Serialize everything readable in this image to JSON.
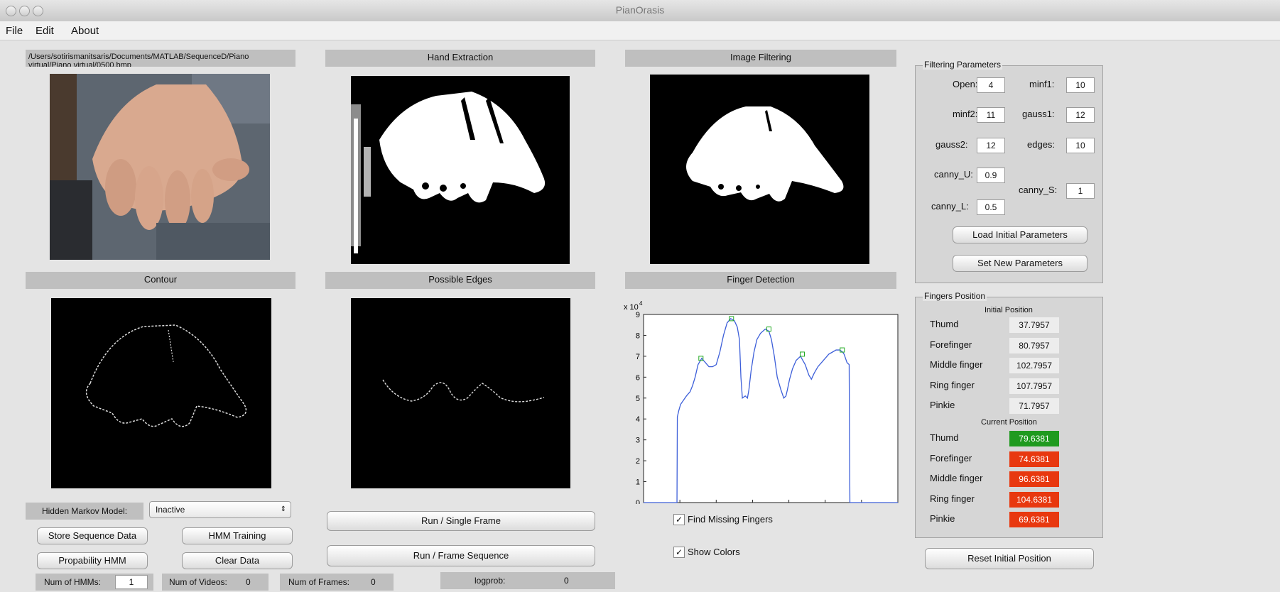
{
  "window": {
    "title": "PianOrasis"
  },
  "menu": {
    "file": "File",
    "edit": "Edit",
    "about": "About"
  },
  "source": {
    "path": "/Users/sotirismanitsaris/Documents/MATLAB/SequenceD/Piano virtual/Piano virtual/0500.bmp"
  },
  "panels": {
    "hand_extraction": "Hand Extraction",
    "image_filtering": "Image Filtering",
    "contour": "Contour",
    "possible_edges": "Possible Edges",
    "finger_detection": "Finger Detection"
  },
  "filtering": {
    "title": "Filtering Parameters",
    "open_label": "Open:",
    "open": "4",
    "minf1_label": "minf1:",
    "minf1": "10",
    "minf2_label": "minf2:",
    "minf2": "11",
    "gauss1_label": "gauss1:",
    "gauss1": "12",
    "gauss2_label": "gauss2:",
    "gauss2": "12",
    "edges_label": "edges:",
    "edges": "10",
    "canny_u_label": "canny_U:",
    "canny_u": "0.9",
    "canny_s_label": "canny_S:",
    "canny_s": "1",
    "canny_l_label": "canny_L:",
    "canny_l": "0.5",
    "load_button": "Load Initial Parameters",
    "set_button": "Set New Parameters"
  },
  "fingers": {
    "title": "Fingers Position",
    "initial_header": "Initial Position",
    "current_header": "Current Position",
    "initial": [
      {
        "name": "Thumd",
        "value": "37.7957"
      },
      {
        "name": "Forefinger",
        "value": "80.7957"
      },
      {
        "name": "Middle finger",
        "value": "102.7957"
      },
      {
        "name": "Ring finger",
        "value": "107.7957"
      },
      {
        "name": "Pinkie",
        "value": "71.7957"
      }
    ],
    "current": [
      {
        "name": "Thumd",
        "value": "79.6381",
        "color": "#1f9a1f"
      },
      {
        "name": "Forefinger",
        "value": "74.6381",
        "color": "#e8380f"
      },
      {
        "name": "Middle finger",
        "value": "96.6381",
        "color": "#e8380f"
      },
      {
        "name": "Ring finger",
        "value": "104.6381",
        "color": "#e8380f"
      },
      {
        "name": "Pinkie",
        "value": "69.6381",
        "color": "#e8380f"
      }
    ],
    "reset_button": "Reset Initial Position"
  },
  "hmm": {
    "label": "Hidden Markov Model:",
    "select_value": "Inactive",
    "store_button": "Store Sequence Data",
    "training_button": "HMM Training",
    "probability_button": "Propability HMM",
    "clear_button": "Clear Data",
    "num_hmms_label": "Num of HMMs:",
    "num_hmms": "1",
    "num_videos_label": "Num of Videos:",
    "num_videos": "0",
    "num_frames_label": "Num of Frames:",
    "num_frames": "0",
    "logprob_label": "logprob:",
    "logprob": "0"
  },
  "run": {
    "single": "Run / Single Frame",
    "sequence": "Run / Frame Sequence"
  },
  "options": {
    "find_missing": "Find Missing Fingers",
    "show_colors": "Show Colors",
    "checkmark": "✓"
  },
  "chart_data": {
    "type": "line",
    "exponent_label": "x 10",
    "exponent_power": "4",
    "xlim": [
      0,
      700
    ],
    "ylim": [
      0,
      9
    ],
    "xticks": [
      0,
      100,
      200,
      300,
      400,
      500,
      600,
      700
    ],
    "yticks": [
      0,
      1,
      2,
      3,
      4,
      5,
      6,
      7,
      8,
      9
    ],
    "grid": false,
    "series": [
      {
        "color": "#3d5fd9",
        "x": [
          0,
          92,
          93,
          97,
          102,
          110,
          118,
          128,
          135,
          142,
          150,
          160,
          170,
          180,
          190,
          200,
          210,
          220,
          230,
          240,
          250,
          258,
          264,
          268,
          272,
          280,
          286,
          290,
          296,
          304,
          312,
          322,
          335,
          345,
          352,
          360,
          368,
          378,
          386,
          392,
          396,
          402,
          410,
          420,
          432,
          445,
          455,
          462,
          470,
          480,
          490,
          500,
          510,
          520,
          530,
          540,
          548,
          552,
          556,
          558,
          560,
          566,
          567,
          568,
          700
        ],
        "y": [
          0,
          0,
          4.1,
          4.4,
          4.7,
          4.9,
          5.1,
          5.3,
          5.6,
          6.0,
          6.6,
          6.9,
          6.7,
          6.5,
          6.5,
          6.6,
          7.2,
          8.0,
          8.6,
          8.8,
          8.7,
          8.4,
          7.8,
          6.0,
          5.0,
          5.1,
          5.0,
          5.4,
          6.3,
          7.2,
          7.8,
          8.1,
          8.3,
          8.2,
          7.8,
          7.0,
          6.0,
          5.4,
          5.0,
          5.1,
          5.4,
          5.9,
          6.4,
          6.8,
          7.0,
          6.6,
          6.1,
          5.9,
          6.2,
          6.5,
          6.7,
          6.9,
          7.1,
          7.2,
          7.3,
          7.3,
          7.2,
          7.1,
          6.9,
          6.8,
          6.7,
          6.6,
          3.0,
          0,
          0
        ]
      },
      {
        "color": "#22aa22",
        "marker": "square",
        "x": [
          158,
          242,
          345,
          437,
          547
        ],
        "y": [
          6.9,
          8.8,
          8.3,
          7.1,
          7.3
        ]
      }
    ]
  }
}
